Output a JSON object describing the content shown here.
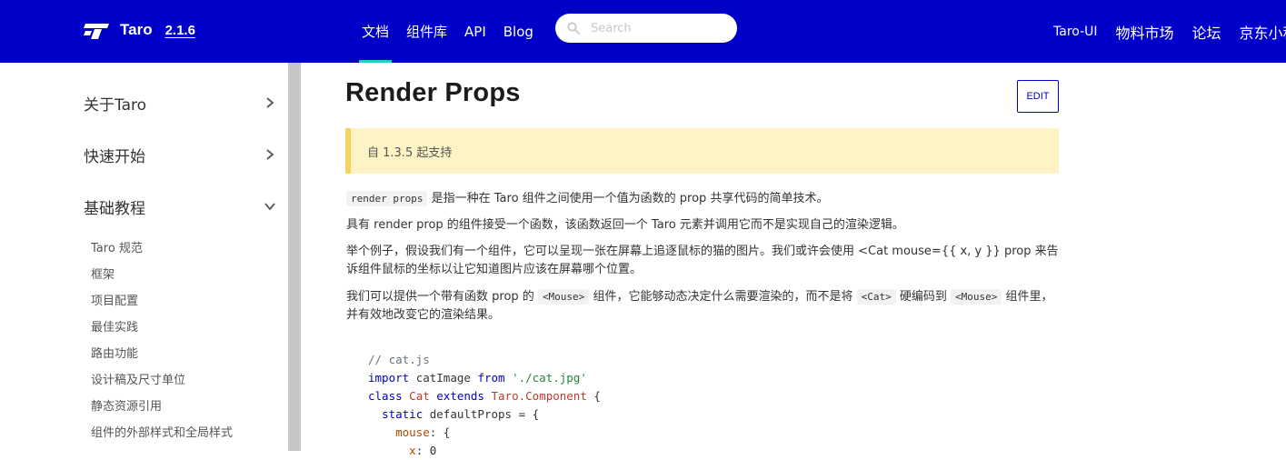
{
  "header": {
    "brand": "Taro",
    "version": "2.1.6",
    "nav": [
      {
        "label": "文档",
        "active": true
      },
      {
        "label": "组件库"
      },
      {
        "label": "API"
      },
      {
        "label": "Blog"
      }
    ],
    "search_placeholder": "Search",
    "right_nav": [
      "Taro-UI",
      "物料市场",
      "论坛",
      "京东小程"
    ],
    "colors": {
      "bar": "#0000c8",
      "active_underline": "#27d2b0"
    }
  },
  "sidebar": {
    "categories": [
      {
        "label": "关于Taro",
        "expanded": false
      },
      {
        "label": "快速开始",
        "expanded": false
      },
      {
        "label": "基础教程",
        "expanded": true
      }
    ],
    "items": [
      "Taro 规范",
      "框架",
      "项目配置",
      "最佳实践",
      "路由功能",
      "设计稿及尺寸单位",
      "静态资源引用",
      "组件的外部样式和全局样式"
    ]
  },
  "main": {
    "title": "Render Props",
    "edit_label": "EDIT",
    "notice": "自 1.3.5 起支持",
    "p1": {
      "code": "render props",
      "text": "是指一种在 Taro 组件之间使用一个值为函数的 prop 共享代码的简单技术。"
    },
    "p2": "具有 render prop 的组件接受一个函数，该函数返回一个 Taro 元素并调用它而不是实现自己的渲染逻辑。",
    "p3": "举个例子，假设我们有一个组件，它可以呈现一张在屏幕上追逐鼠标的猫的图片。我们或许会使用 <Cat mouse={{ x, y }} prop 来告诉组件鼠标的坐标以让它知道图片应该在屏幕哪个位置。",
    "p4": {
      "t1": "我们可以提供一个带有函数 prop 的",
      "c1": "<Mouse>",
      "t2": "组件，它能够动态决定什么需要渲染的，而不是将",
      "c2": "<Cat>",
      "t3": "硬编码到",
      "c3": "<Mouse>",
      "t4": "组件里，并有效地改变它的渲染结果。"
    },
    "code": {
      "l1": "// cat.js",
      "l2_kw": "import",
      "l2_id": "catImage",
      "l2_from": "from",
      "l2_str": "'./cat.jpg'",
      "l3_kw": "class",
      "l3_cls": "Cat",
      "l3_ext": "extends",
      "l3_parent": "Taro.Component",
      "l3_brace": "{",
      "l4_kw": "static",
      "l4_id": "defaultProps",
      "l4_rest": "= {",
      "l5_prop": "mouse",
      "l5_rest": ": {",
      "l6_prop": "x",
      "l6_rest": ": 0"
    }
  }
}
